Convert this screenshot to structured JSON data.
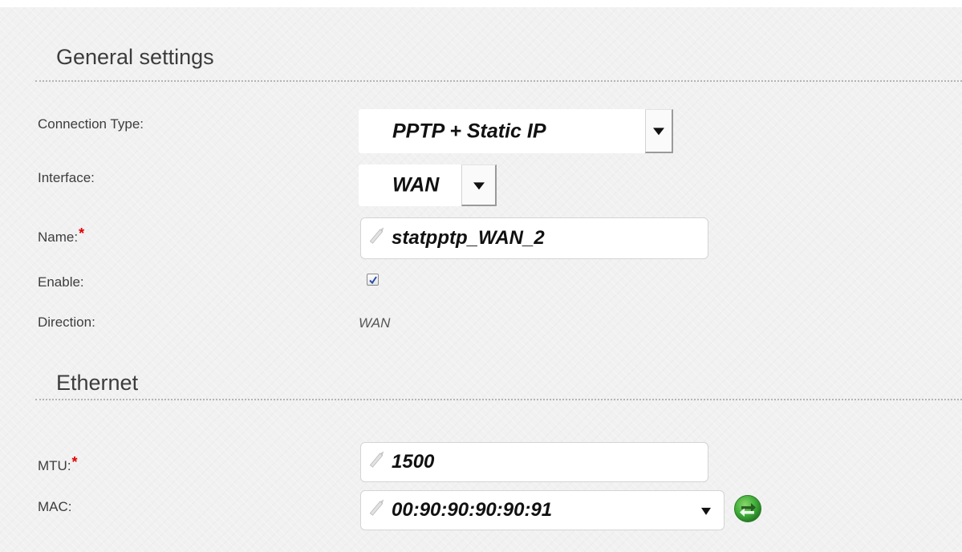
{
  "general": {
    "title": "General settings",
    "connection_type": {
      "label": "Connection Type:",
      "value": "PPTP + Static IP"
    },
    "interface": {
      "label": "Interface:",
      "value": "WAN"
    },
    "name": {
      "label": "Name:",
      "required_mark": "*",
      "value": "statpptp_WAN_2"
    },
    "enable": {
      "label": "Enable:",
      "checked": true
    },
    "direction": {
      "label": "Direction:",
      "value": "WAN"
    }
  },
  "ethernet": {
    "title": "Ethernet",
    "mtu": {
      "label": "MTU:",
      "required_mark": "*",
      "value": "1500"
    },
    "mac": {
      "label": "MAC:",
      "value": "00:90:90:90:90:91"
    }
  },
  "icons": {
    "edit": "pencil-icon",
    "dropdown": "chevron-down-icon",
    "refresh": "refresh-arrows-icon"
  },
  "colors": {
    "required": "#e00000",
    "refresh_button": "#3fae3a"
  }
}
